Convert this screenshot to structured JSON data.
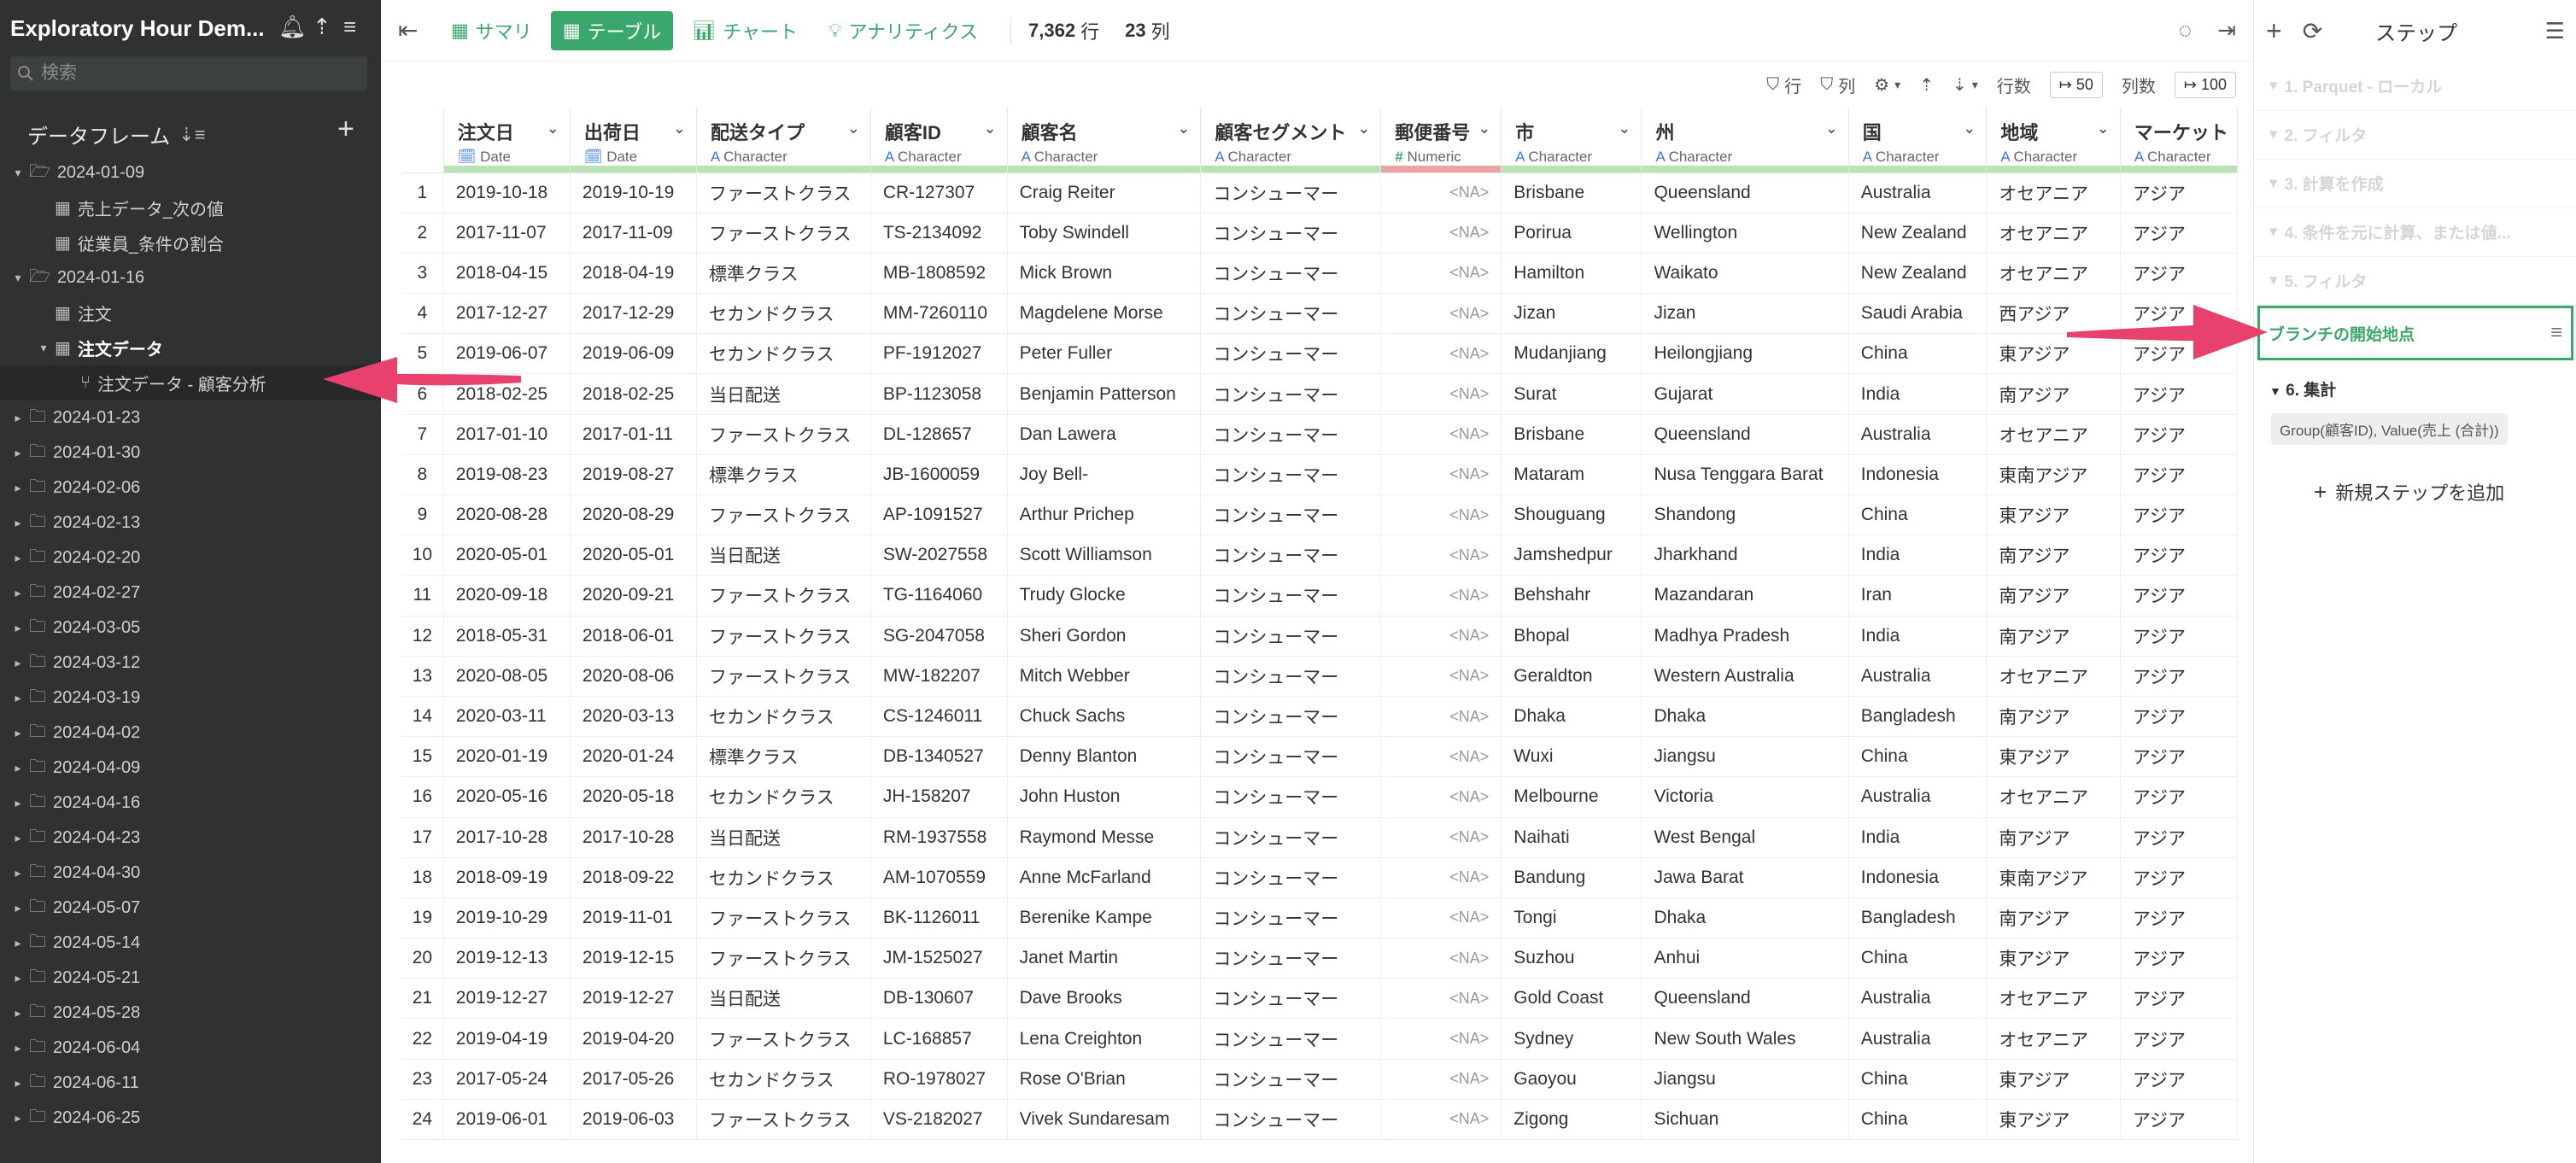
{
  "sidebar": {
    "title": "Exploratory Hour Dem...",
    "search_placeholder": "検索",
    "section_label": "データフレーム",
    "tree": [
      {
        "label": "2024-01-09",
        "kind": "folder",
        "open": true,
        "indent": 0
      },
      {
        "label": "売上データ_次の値",
        "kind": "table",
        "indent": 1
      },
      {
        "label": "従業員_条件の割合",
        "kind": "table",
        "indent": 1
      },
      {
        "label": "2024-01-16",
        "kind": "folder",
        "open": true,
        "indent": 0
      },
      {
        "label": "注文",
        "kind": "table",
        "indent": 1
      },
      {
        "label": "注文データ",
        "kind": "table",
        "open": true,
        "bold": true,
        "indent": 1
      },
      {
        "label": "注文データ - 顧客分析",
        "kind": "branch",
        "selected": true,
        "indent": 2
      },
      {
        "label": "2024-01-23",
        "kind": "folder",
        "indent": 0
      },
      {
        "label": "2024-01-30",
        "kind": "folder",
        "indent": 0
      },
      {
        "label": "2024-02-06",
        "kind": "folder",
        "indent": 0
      },
      {
        "label": "2024-02-13",
        "kind": "folder",
        "indent": 0
      },
      {
        "label": "2024-02-20",
        "kind": "folder",
        "indent": 0
      },
      {
        "label": "2024-02-27",
        "kind": "folder",
        "indent": 0
      },
      {
        "label": "2024-03-05",
        "kind": "folder",
        "indent": 0
      },
      {
        "label": "2024-03-12",
        "kind": "folder",
        "indent": 0
      },
      {
        "label": "2024-03-19",
        "kind": "folder",
        "indent": 0
      },
      {
        "label": "2024-04-02",
        "kind": "folder",
        "indent": 0
      },
      {
        "label": "2024-04-09",
        "kind": "folder",
        "indent": 0
      },
      {
        "label": "2024-04-16",
        "kind": "folder",
        "indent": 0
      },
      {
        "label": "2024-04-23",
        "kind": "folder",
        "indent": 0
      },
      {
        "label": "2024-04-30",
        "kind": "folder",
        "indent": 0
      },
      {
        "label": "2024-05-07",
        "kind": "folder",
        "indent": 0
      },
      {
        "label": "2024-05-14",
        "kind": "folder",
        "indent": 0
      },
      {
        "label": "2024-05-21",
        "kind": "folder",
        "indent": 0
      },
      {
        "label": "2024-05-28",
        "kind": "folder",
        "indent": 0
      },
      {
        "label": "2024-06-04",
        "kind": "folder",
        "indent": 0
      },
      {
        "label": "2024-06-11",
        "kind": "folder",
        "indent": 0
      },
      {
        "label": "2024-06-25",
        "kind": "folder",
        "indent": 0
      }
    ]
  },
  "toolbar": {
    "tabs": [
      {
        "label": "サマリ",
        "icon": "summary-icon"
      },
      {
        "label": "テーブル",
        "icon": "table-icon",
        "active": true
      },
      {
        "label": "チャート",
        "icon": "chart-icon"
      },
      {
        "label": "アナリティクス",
        "icon": "bulb-icon"
      }
    ],
    "rows_count": "7,362",
    "rows_unit": "行",
    "cols_count": "23",
    "cols_unit": "列"
  },
  "subbar": {
    "row_filter": "行",
    "col_filter": "列",
    "rows_label": "行数",
    "rows_value": "↦ 50",
    "cols_label": "列数",
    "cols_value": "↦ 100"
  },
  "table": {
    "columns": [
      {
        "name": "注文日",
        "type": "Date"
      },
      {
        "name": "出荷日",
        "type": "Date"
      },
      {
        "name": "配送タイプ",
        "type": "Character"
      },
      {
        "name": "顧客ID",
        "type": "Character"
      },
      {
        "name": "顧客名",
        "type": "Character"
      },
      {
        "name": "顧客セグメント",
        "type": "Character"
      },
      {
        "name": "郵便番号",
        "type": "Numeric"
      },
      {
        "name": "市",
        "type": "Character"
      },
      {
        "name": "州",
        "type": "Character"
      },
      {
        "name": "国",
        "type": "Character"
      },
      {
        "name": "地域",
        "type": "Character"
      },
      {
        "name": "マーケット",
        "type": "Character"
      }
    ],
    "rows": [
      [
        "2019-10-18",
        "2019-10-19",
        "ファーストクラス",
        "CR-127307",
        "Craig Reiter",
        "コンシューマー",
        "<NA>",
        "Brisbane",
        "Queensland",
        "Australia",
        "オセアニア",
        "アジア"
      ],
      [
        "2017-11-07",
        "2017-11-09",
        "ファーストクラス",
        "TS-2134092",
        "Toby Swindell",
        "コンシューマー",
        "<NA>",
        "Porirua",
        "Wellington",
        "New Zealand",
        "オセアニア",
        "アジア"
      ],
      [
        "2018-04-15",
        "2018-04-19",
        "標準クラス",
        "MB-1808592",
        "Mick Brown",
        "コンシューマー",
        "<NA>",
        "Hamilton",
        "Waikato",
        "New Zealand",
        "オセアニア",
        "アジア"
      ],
      [
        "2017-12-27",
        "2017-12-29",
        "セカンドクラス",
        "MM-7260110",
        "Magdelene Morse",
        "コンシューマー",
        "<NA>",
        "Jizan",
        "Jizan",
        "Saudi Arabia",
        "西アジア",
        "アジア"
      ],
      [
        "2019-06-07",
        "2019-06-09",
        "セカンドクラス",
        "PF-1912027",
        "Peter Fuller",
        "コンシューマー",
        "<NA>",
        "Mudanjiang",
        "Heilongjiang",
        "China",
        "東アジア",
        "アジア"
      ],
      [
        "2018-02-25",
        "2018-02-25",
        "当日配送",
        "BP-1123058",
        "Benjamin Patterson",
        "コンシューマー",
        "<NA>",
        "Surat",
        "Gujarat",
        "India",
        "南アジア",
        "アジア"
      ],
      [
        "2017-01-10",
        "2017-01-11",
        "ファーストクラス",
        "DL-128657",
        "Dan Lawera",
        "コンシューマー",
        "<NA>",
        "Brisbane",
        "Queensland",
        "Australia",
        "オセアニア",
        "アジア"
      ],
      [
        "2019-08-23",
        "2019-08-27",
        "標準クラス",
        "JB-1600059",
        "Joy Bell-",
        "コンシューマー",
        "<NA>",
        "Mataram",
        "Nusa Tenggara Barat",
        "Indonesia",
        "東南アジア",
        "アジア"
      ],
      [
        "2020-08-28",
        "2020-08-29",
        "ファーストクラス",
        "AP-1091527",
        "Arthur Prichep",
        "コンシューマー",
        "<NA>",
        "Shouguang",
        "Shandong",
        "China",
        "東アジア",
        "アジア"
      ],
      [
        "2020-05-01",
        "2020-05-01",
        "当日配送",
        "SW-2027558",
        "Scott Williamson",
        "コンシューマー",
        "<NA>",
        "Jamshedpur",
        "Jharkhand",
        "India",
        "南アジア",
        "アジア"
      ],
      [
        "2020-09-18",
        "2020-09-21",
        "ファーストクラス",
        "TG-1164060",
        "Trudy Glocke",
        "コンシューマー",
        "<NA>",
        "Behshahr",
        "Mazandaran",
        "Iran",
        "南アジア",
        "アジア"
      ],
      [
        "2018-05-31",
        "2018-06-01",
        "ファーストクラス",
        "SG-2047058",
        "Sheri Gordon",
        "コンシューマー",
        "<NA>",
        "Bhopal",
        "Madhya Pradesh",
        "India",
        "南アジア",
        "アジア"
      ],
      [
        "2020-08-05",
        "2020-08-06",
        "ファーストクラス",
        "MW-182207",
        "Mitch Webber",
        "コンシューマー",
        "<NA>",
        "Geraldton",
        "Western Australia",
        "Australia",
        "オセアニア",
        "アジア"
      ],
      [
        "2020-03-11",
        "2020-03-13",
        "セカンドクラス",
        "CS-1246011",
        "Chuck Sachs",
        "コンシューマー",
        "<NA>",
        "Dhaka",
        "Dhaka",
        "Bangladesh",
        "南アジア",
        "アジア"
      ],
      [
        "2020-01-19",
        "2020-01-24",
        "標準クラス",
        "DB-1340527",
        "Denny Blanton",
        "コンシューマー",
        "<NA>",
        "Wuxi",
        "Jiangsu",
        "China",
        "東アジア",
        "アジア"
      ],
      [
        "2020-05-16",
        "2020-05-18",
        "セカンドクラス",
        "JH-158207",
        "John Huston",
        "コンシューマー",
        "<NA>",
        "Melbourne",
        "Victoria",
        "Australia",
        "オセアニア",
        "アジア"
      ],
      [
        "2017-10-28",
        "2017-10-28",
        "当日配送",
        "RM-1937558",
        "Raymond Messe",
        "コンシューマー",
        "<NA>",
        "Naihati",
        "West Bengal",
        "India",
        "南アジア",
        "アジア"
      ],
      [
        "2018-09-19",
        "2018-09-22",
        "セカンドクラス",
        "AM-1070559",
        "Anne McFarland",
        "コンシューマー",
        "<NA>",
        "Bandung",
        "Jawa Barat",
        "Indonesia",
        "東南アジア",
        "アジア"
      ],
      [
        "2019-10-29",
        "2019-11-01",
        "ファーストクラス",
        "BK-1126011",
        "Berenike Kampe",
        "コンシューマー",
        "<NA>",
        "Tongi",
        "Dhaka",
        "Bangladesh",
        "南アジア",
        "アジア"
      ],
      [
        "2019-12-13",
        "2019-12-15",
        "ファーストクラス",
        "JM-1525027",
        "Janet Martin",
        "コンシューマー",
        "<NA>",
        "Suzhou",
        "Anhui",
        "China",
        "東アジア",
        "アジア"
      ],
      [
        "2019-12-27",
        "2019-12-27",
        "当日配送",
        "DB-130607",
        "Dave Brooks",
        "コンシューマー",
        "<NA>",
        "Gold Coast",
        "Queensland",
        "Australia",
        "オセアニア",
        "アジア"
      ],
      [
        "2019-04-19",
        "2019-04-20",
        "ファーストクラス",
        "LC-168857",
        "Lena Creighton",
        "コンシューマー",
        "<NA>",
        "Sydney",
        "New South Wales",
        "Australia",
        "オセアニア",
        "アジア"
      ],
      [
        "2017-05-24",
        "2017-05-26",
        "セカンドクラス",
        "RO-1978027",
        "Rose O'Brian",
        "コンシューマー",
        "<NA>",
        "Gaoyou",
        "Jiangsu",
        "China",
        "東アジア",
        "アジア"
      ],
      [
        "2019-06-01",
        "2019-06-03",
        "ファーストクラス",
        "VS-2182027",
        "Vivek Sundaresam",
        "コンシューマー",
        "<NA>",
        "Zigong",
        "Sichuan",
        "China",
        "東アジア",
        "アジア"
      ]
    ]
  },
  "steps_panel": {
    "title": "ステップ",
    "steps": [
      "1. Parquet - ローカル",
      "2. フィルタ",
      "3. 計算を作成",
      "4. 条件を元に計算、または値...",
      "5. フィルタ"
    ],
    "branch_label": "ブランチの開始地点",
    "agg_label": "6. 集計",
    "agg_detail": "Group(顧客ID), Value(売上 (合計))",
    "add_step_label": "新規ステップを追加"
  },
  "colors": {
    "accent": "#3aa76d",
    "sidebar_bg": "#2f3132",
    "arrow": "#e8416e",
    "type_bar_ok": "#b9e3b4",
    "type_bar_na": "#eaa4a4"
  }
}
